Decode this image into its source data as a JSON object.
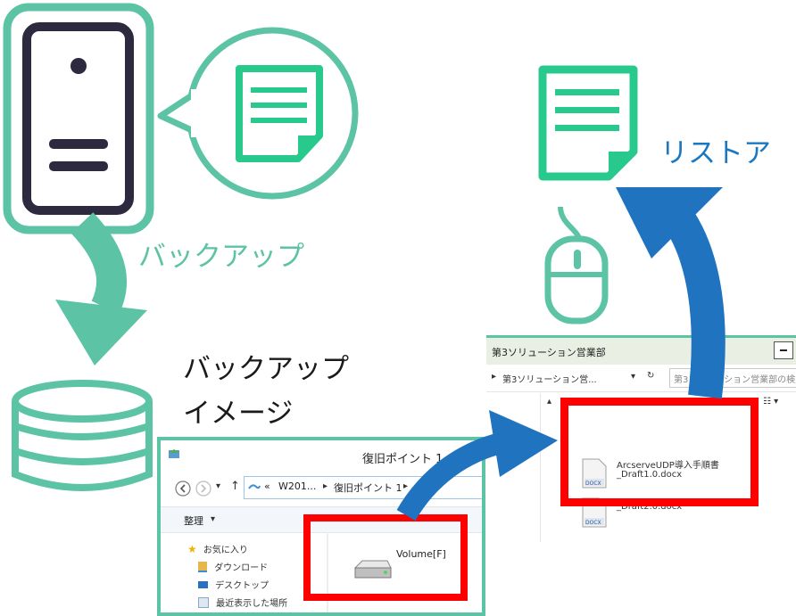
{
  "labels": {
    "backup": "バックアップ",
    "backup_image_line1": "バックアップ",
    "backup_image_line2": "イメージ",
    "restore": "リストア"
  },
  "explorer_left": {
    "title": "復旧ポイント 1",
    "path_prefix": "«",
    "path_seg1": "W201...",
    "path_seg2": "復旧ポイント 1",
    "organize": "整理",
    "favorites": "お気に入り",
    "nav_items": [
      "ダウンロード",
      "デスクトップ",
      "最近表示した場所"
    ],
    "volume_label": "Volume[F]"
  },
  "explorer_right": {
    "title": "第3ソリューション営業部",
    "path": "第3ソリューション営...",
    "search_placeholder": "第3ソリューション営業部の検",
    "files": [
      {
        "name_line1": "ArcserveUDP導入手順書",
        "name_line2": "_Draft1.0.docx",
        "type": "docx"
      },
      {
        "name_line1": "",
        "name_line2": "_Draft2.0.docx",
        "type": "docx"
      }
    ]
  },
  "colors": {
    "teal": "#5cc3a4",
    "teal_dark": "#3bb08a",
    "doc_green": "#28c98c",
    "navy": "#2d2a3f",
    "blue": "#1f73bf",
    "red": "#ff0000"
  }
}
